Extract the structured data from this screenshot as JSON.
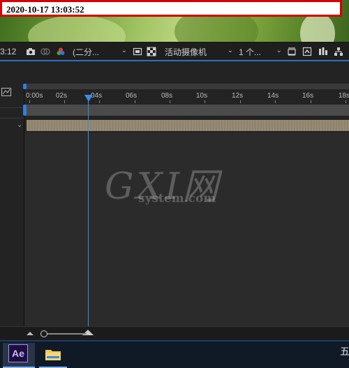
{
  "timestamp": "2020-10-17  13:03:52",
  "viewer_toolbar": {
    "time_fragment": "3:12",
    "resolution": "(二分...",
    "camera": "活动摄像机",
    "views": "1 个..."
  },
  "timeline": {
    "ticks": [
      "0:00s",
      "02s",
      "04s",
      "06s",
      "08s",
      "10s",
      "12s",
      "14s",
      "16s",
      "18s"
    ],
    "playhead_time_seconds": 3.6
  },
  "watermark": {
    "main": "GXI网",
    "sub": "system.com"
  },
  "taskbar": {
    "ae_label": "Ae",
    "tray_char": "五"
  },
  "colors": {
    "accent": "#2d7fe0",
    "timestamp_border": "#d60000",
    "layer_bar": "#8f8470"
  }
}
